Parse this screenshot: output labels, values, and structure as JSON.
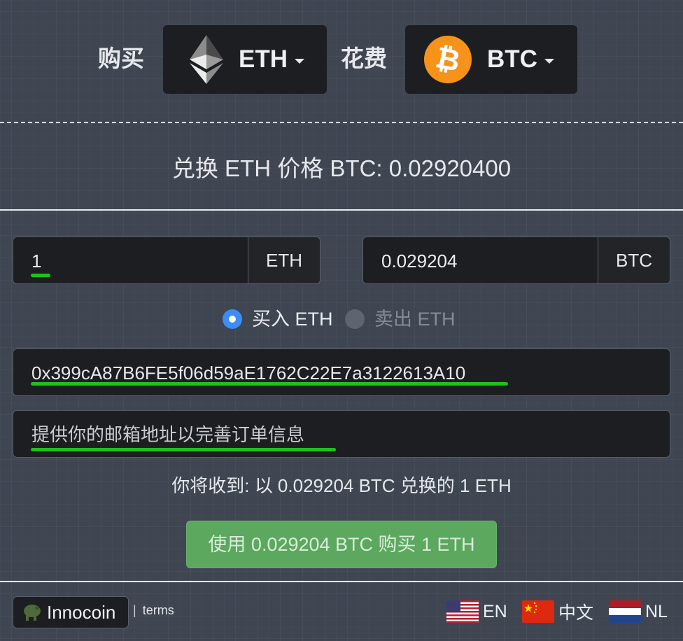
{
  "header": {
    "buy_label": "购买",
    "spend_label": "花费",
    "buy_coin": "ETH",
    "spend_coin": "BTC"
  },
  "rate": {
    "text": "兑换 ETH 价格 BTC: 0.02920400"
  },
  "amounts": {
    "buy_value": "1",
    "buy_unit": "ETH",
    "spend_value": "0.029204",
    "spend_unit": "BTC"
  },
  "mode": {
    "buy_label": "买入 ETH",
    "sell_label": "卖出 ETH",
    "selected": "buy"
  },
  "fields": {
    "address_value": "0x399cA87B6FE5f06d59aE1762C22E7a3122613A10",
    "email_placeholder": "提供你的邮箱地址以完善订单信息"
  },
  "summary": {
    "receive_text": "你将收到: 以 0.029204 BTC 兑换的 1 ETH"
  },
  "action": {
    "buy_button": "使用 0.029204 BTC 购买 1 ETH"
  },
  "footer": {
    "brand": "Innocoin",
    "separator": "|",
    "terms": "terms",
    "languages": [
      {
        "label": "EN",
        "flag": "us-flag-icon"
      },
      {
        "label": "中文",
        "flag": "cn-flag-icon"
      },
      {
        "label": "NL",
        "flag": "nl-flag-icon"
      }
    ]
  },
  "colors": {
    "background": "#3f4652",
    "panel": "#1c1e22",
    "accent_radio": "#3c8df5",
    "buy_button": "#5ba85e",
    "highlight_underline": "#1fc21c",
    "btc_orange": "#f7931a"
  }
}
